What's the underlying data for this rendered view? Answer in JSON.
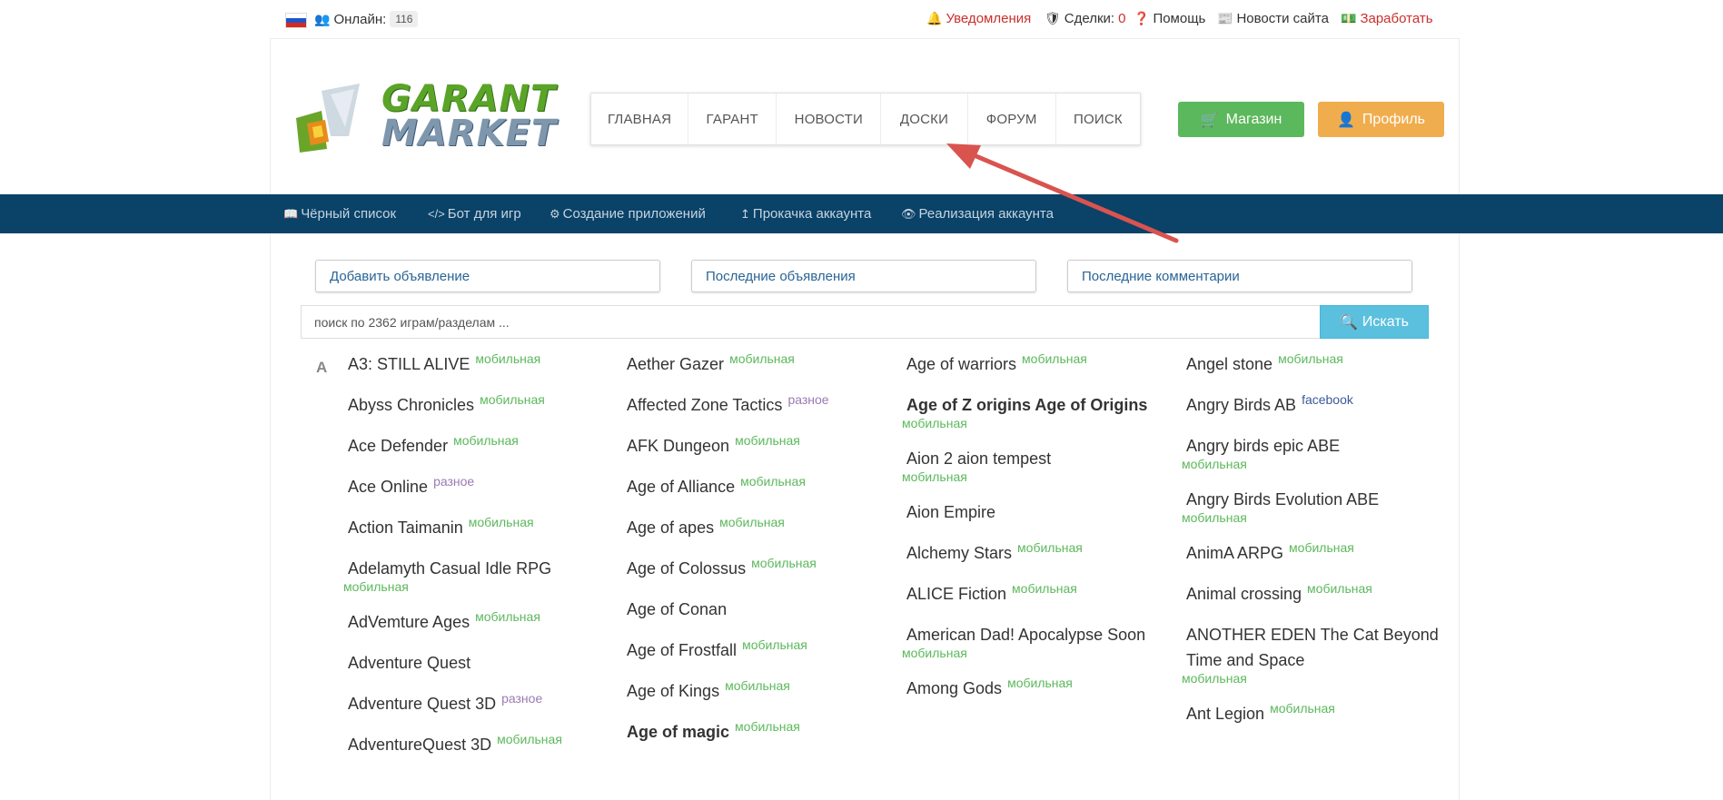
{
  "topbar": {
    "online_label": "Онлайн:",
    "online_count": "116",
    "notifications": "Уведомления",
    "deals_label": "Сделки:",
    "deals_count": "0",
    "help": "Помощь",
    "site_news": "Новости сайта",
    "earn": "Заработать"
  },
  "logo": {
    "line1": "GARANT",
    "line2": "MARKET"
  },
  "nav": [
    {
      "label": "ГЛАВНАЯ"
    },
    {
      "label": "ГАРАНТ"
    },
    {
      "label": "НОВОСТИ"
    },
    {
      "label": "ДОСКИ"
    },
    {
      "label": "ФОРУМ"
    },
    {
      "label": "ПОИСК"
    }
  ],
  "buttons": {
    "shop": "Магазин",
    "profile": "Профиль"
  },
  "subnav": [
    {
      "label": "Чёрный список",
      "icon": "book-icon"
    },
    {
      "label": "Бот для игр",
      "icon": "code-icon"
    },
    {
      "label": "Создание приложений",
      "icon": "cogs-icon"
    },
    {
      "label": "Прокачка аккаунта",
      "icon": "arrow-up-icon"
    },
    {
      "label": "Реализация аккаунта",
      "icon": "eye-icon"
    }
  ],
  "quick_links": {
    "add_ad": "Добавить объявление",
    "last_ads": "Последние объявления",
    "last_comments": "Последние комментарии"
  },
  "search": {
    "placeholder": "поиск по 2362 играм/разделам ...",
    "button": "Искать"
  },
  "letter": "A",
  "columns": [
    [
      {
        "name": "A3: STILL ALIVE",
        "tag": "мобильная"
      },
      {
        "name": "Abyss Chronicles",
        "tag": "мобильная"
      },
      {
        "name": "Ace Defender",
        "tag": "мобильная"
      },
      {
        "name": "Ace Online",
        "tag": "разное"
      },
      {
        "name": "Action Taimanin",
        "tag": "мобильная"
      },
      {
        "name": "Adelamyth Casual Idle RPG",
        "tag": "мобильная",
        "wrap": true
      },
      {
        "name": "AdVemture Ages",
        "tag": "мобильная"
      },
      {
        "name": "Adventure Quest",
        "tag": ""
      },
      {
        "name": "Adventure Quest 3D",
        "tag": "разное"
      },
      {
        "name": "AdventureQuest 3D",
        "tag": "мобильная"
      }
    ],
    [
      {
        "name": "Aether Gazer",
        "tag": "мобильная"
      },
      {
        "name": "Affected Zone Tactics",
        "tag": "разное"
      },
      {
        "name": "AFK Dungeon",
        "tag": "мобильная"
      },
      {
        "name": "Age of Alliance",
        "tag": "мобильная"
      },
      {
        "name": "Age of apes",
        "tag": "мобильная"
      },
      {
        "name": "Age of Colossus",
        "tag": "мобильная"
      },
      {
        "name": "Age of Conan",
        "tag": ""
      },
      {
        "name": "Age of Frostfall",
        "tag": "мобильная"
      },
      {
        "name": "Age of Kings",
        "tag": "мобильная"
      },
      {
        "name": "Age of magic",
        "tag": "мобильная",
        "bold": true
      }
    ],
    [
      {
        "name": "Age of warriors",
        "tag": "мобильная"
      },
      {
        "name": "Age of Z origins Age of Origins",
        "tag": "мобильная",
        "wrap": true,
        "bold": true
      },
      {
        "name": "Aion 2 aion tempest",
        "tag": "мобильная",
        "wrap": true
      },
      {
        "name": "Aion Empire",
        "tag": ""
      },
      {
        "name": "Alchemy Stars",
        "tag": "мобильная"
      },
      {
        "name": "ALICE Fiction",
        "tag": "мобильная"
      },
      {
        "name": "American Dad! Apocalypse Soon",
        "tag": "мобильная",
        "wrap": true
      },
      {
        "name": "Among Gods",
        "tag": "мобильная"
      }
    ],
    [
      {
        "name": "Angel stone",
        "tag": "мобильная"
      },
      {
        "name": "Angry Birds AB",
        "tag": "facebook"
      },
      {
        "name": "Angry birds epic ABE",
        "tag": "мобильная",
        "wrap": true
      },
      {
        "name": "Angry Birds Evolution ABE",
        "tag": "мобильная",
        "wrap": true
      },
      {
        "name": "AnimA ARPG",
        "tag": "мобильная"
      },
      {
        "name": "Animal crossing",
        "tag": "мобильная"
      },
      {
        "name": "ANOTHER EDEN The Cat Beyond Time and Space",
        "tag": "мобильная",
        "wrap": true
      },
      {
        "name": "Ant Legion",
        "tag": "мобильная"
      }
    ]
  ],
  "colors": {
    "navy": "#0a4268",
    "green": "#5cb85c",
    "orange": "#f0ad4e",
    "red": "#c9302c",
    "info": "#5bc0de",
    "arrow": "#d9534f"
  }
}
